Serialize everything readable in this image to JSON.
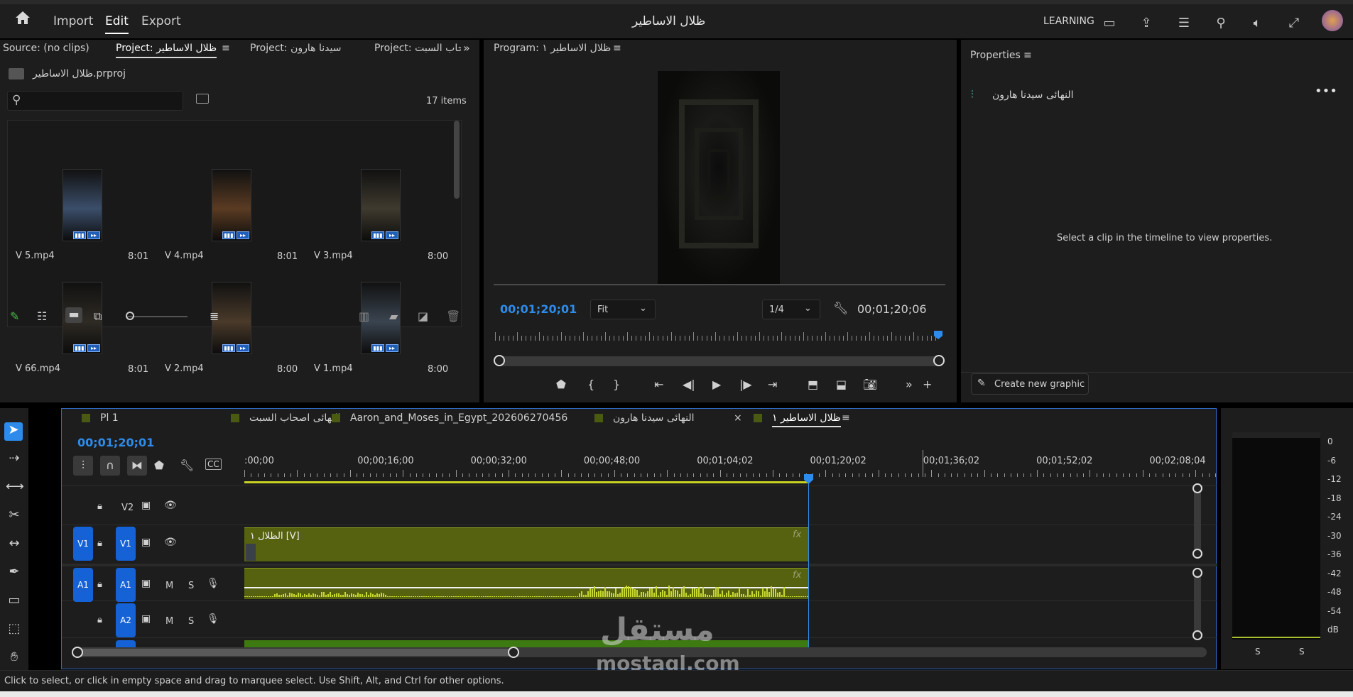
{
  "app": {
    "title": "ظلال الاساطير",
    "menu": [
      "Import",
      "Edit",
      "Export"
    ],
    "workspace": "LEARNING"
  },
  "project_panel": {
    "tabs": [
      "Source: (no clips)",
      "Project: ظلال الاساطير",
      "Project: سيدنا هارون",
      "Project: حاب السبت"
    ],
    "file": "ظلال الاساطير.prproj",
    "items_count": "17 items",
    "search_placeholder": "",
    "clips": [
      {
        "name": "V 5.mp4",
        "dur": "8:01",
        "tint": "#3b4e6a"
      },
      {
        "name": "V 4.mp4",
        "dur": "8:01",
        "tint": "#5a3b22"
      },
      {
        "name": "V 3.mp4",
        "dur": "8:00",
        "tint": "#3f3a2e"
      },
      {
        "name": "V 66.mp4",
        "dur": "8:01",
        "tint": "#2e2a24"
      },
      {
        "name": "V 2.mp4",
        "dur": "8:00",
        "tint": "#4a3a2a"
      },
      {
        "name": "V 1.mp4",
        "dur": "8:00",
        "tint": "#3a4450"
      }
    ]
  },
  "program": {
    "tab": "Program: ظلال الاساطير ١",
    "timecode_in": "00;01;20;01",
    "fit": "Fit",
    "quality": "1/4",
    "timecode_out": "00;01;20;06"
  },
  "properties": {
    "title": "Properties",
    "clip_name": "النهائى سيدنا هارون",
    "hint": "Select a clip in the timeline to view properties.",
    "create_graphic": "Create new graphic"
  },
  "timeline": {
    "tabs": [
      "Pl 1",
      "النهائى اصحاب السبت",
      "Aaron_and_Moses_in_Egypt_202606270456",
      "النهائى سيدنا هارون",
      "ظلال الاساطير ١"
    ],
    "timecode": "00;01;20;01",
    "ruler": [
      ":00;00",
      "00;00;16;00",
      "00;00;32;00",
      "00;00;48;00",
      "00;01;04;02",
      "00;01;20;02",
      "00;01;36;02",
      "00;01;52;02",
      "00;02;08;04"
    ],
    "tracks": {
      "v2": "V2",
      "v1_src": "V1",
      "v1": "V1",
      "a1_src": "A1",
      "a1": "A1",
      "a2": "A2",
      "m": "M",
      "s": "S"
    },
    "clip_label": "الظلال ١ [V]",
    "fx": "fx"
  },
  "meter": {
    "scale": [
      "0",
      "-6",
      "-12",
      "-18",
      "-24",
      "-30",
      "-36",
      "-42",
      "-48",
      "-54",
      "dB"
    ],
    "solo": [
      "S",
      "S"
    ]
  },
  "status": "Click to select, or click in empty space and drag to marquee select. Use Shift, Alt, and Ctrl for other options.",
  "watermark": {
    "arabic": "مستقل",
    "latin": "mostaql.com"
  },
  "colors": {
    "accent": "#2d8ceb",
    "clip": "#5b6a0f",
    "audio": "#3d7a12",
    "track_btn": "#1562d6"
  }
}
